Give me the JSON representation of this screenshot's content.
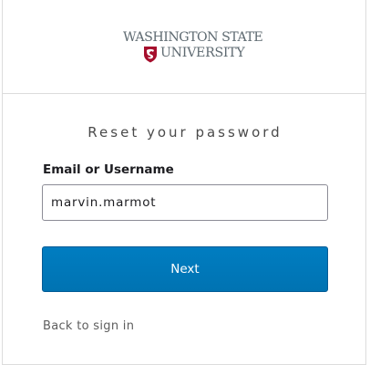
{
  "brand": {
    "line1": "WASHINGTON STATE",
    "line2": "UNIVERSITY",
    "seal_icon": "wsu-cougar-seal-icon",
    "seal_color": "#a60f2d"
  },
  "form": {
    "title": "Reset your password",
    "field_label": "Email or Username",
    "field_value": "marvin.marmot",
    "next_label": "Next",
    "back_link": "Back to sign in",
    "button_color": "#007dc1"
  }
}
